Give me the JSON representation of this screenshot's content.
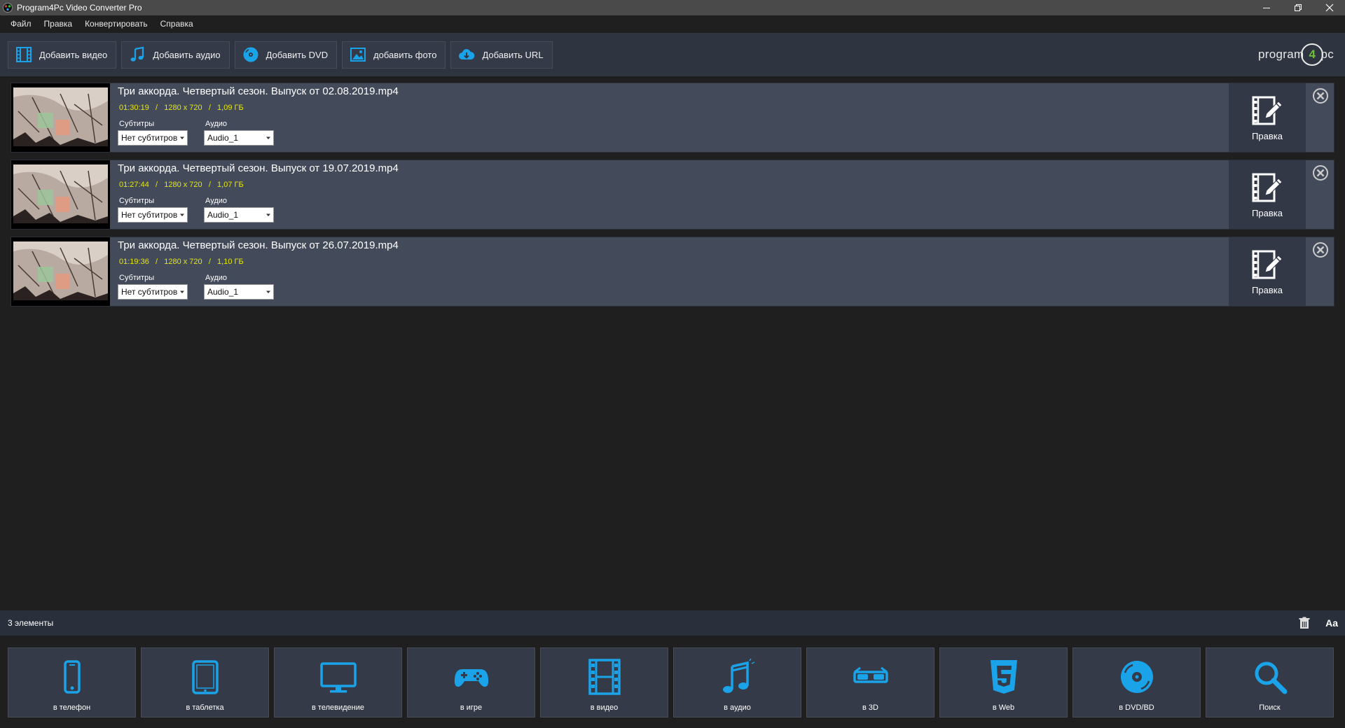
{
  "window": {
    "title": "Program4Pc Video Converter Pro",
    "controls": [
      "minimize",
      "restore",
      "close"
    ]
  },
  "menu": [
    "Файл",
    "Правка",
    "Конвертировать",
    "Справка"
  ],
  "toolbar": {
    "buttons": [
      {
        "label": "Добавить видео",
        "icon": "film-icon"
      },
      {
        "label": "Добавить аудио",
        "icon": "music-note-icon"
      },
      {
        "label": "Добавить DVD",
        "icon": "disc-icon"
      },
      {
        "label": "добавить фото",
        "icon": "image-icon"
      },
      {
        "label": "Добавить URL",
        "icon": "cloud-download-icon"
      }
    ],
    "brand": {
      "pre": "program",
      "num": "4",
      "post": "pc"
    }
  },
  "files": [
    {
      "name": "Три аккорда. Четвертый сезон. Выпуск от 02.08.2019.mp4",
      "meta": "01:30:19   /   1280 x 720   /   1,09 ГБ",
      "subtitles_label": "Субтитры",
      "subtitles_value": "Нет субтитров",
      "audio_label": "Аудио",
      "audio_value": "Audio_1",
      "edit_label": "Правка"
    },
    {
      "name": "Три аккорда. Четвертый сезон. Выпуск от 19.07.2019.mp4",
      "meta": "01:27:44   /   1280 x 720   /   1,07 ГБ",
      "subtitles_label": "Субтитры",
      "subtitles_value": "Нет субтитров",
      "audio_label": "Аудио",
      "audio_value": "Audio_1",
      "edit_label": "Правка"
    },
    {
      "name": "Три аккорда. Четвертый сезон. Выпуск от 26.07.2019.mp4",
      "meta": "01:19:36   /   1280 x 720   /   1,10 ГБ",
      "subtitles_label": "Субтитры",
      "subtitles_value": "Нет субтитров",
      "audio_label": "Аудио",
      "audio_value": "Audio_1",
      "edit_label": "Правка"
    }
  ],
  "status": {
    "count": "3 элементы",
    "font_toggle": "Aa"
  },
  "formats": [
    {
      "label": "в телефон",
      "icon": "phone-icon"
    },
    {
      "label": "в таблетка",
      "icon": "tablet-icon"
    },
    {
      "label": "в телевидение",
      "icon": "tv-icon"
    },
    {
      "label": "в игре",
      "icon": "gamepad-icon"
    },
    {
      "label": "в видео",
      "icon": "film-icon"
    },
    {
      "label": "в аудио",
      "icon": "music-notes-icon"
    },
    {
      "label": "в 3D",
      "icon": "3d-glasses-icon"
    },
    {
      "label": "в Web",
      "icon": "html5-icon"
    },
    {
      "label": "в DVD/BD",
      "icon": "disc-icon"
    },
    {
      "label": "Поиск",
      "icon": "search-icon"
    }
  ],
  "colors": {
    "accent": "#1aa3e8",
    "meta_text": "#e8e800",
    "row_bg": "#434a5a",
    "toolbar_bg": "#2e3440"
  }
}
